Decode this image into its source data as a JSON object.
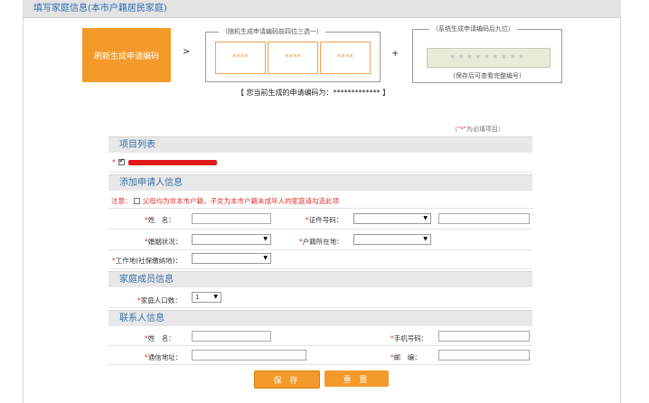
{
  "page": {
    "title": "填写家庭信息(本市户籍居民家庭)"
  },
  "code_gen": {
    "refresh_label": "刷新生成申请编码",
    "gt": ">",
    "plus": "+",
    "random_legend": "（随机生成申请编码前四位三选一）",
    "random_codes": [
      "****",
      "****",
      "****"
    ],
    "system_legend": "（系统生成申请编码后九位）",
    "system_code": "*********",
    "system_note": "(保存后可查看完整编号)",
    "current_code": "【 您当前生成的申请编码为：************* 】"
  },
  "required_note": {
    "prefix": "（",
    "mark": "\"*\"",
    "suffix": "为必填项目）"
  },
  "project_list": {
    "title": "项目列表",
    "item_star": "*"
  },
  "applicant": {
    "title": "添加申请人信息",
    "notice_prefix": "注意：",
    "notice_text": "父母均为非本市户籍，子女为本市户籍未成年人的家庭请勾选此项",
    "name_label": "姓　名：",
    "id_label": "证件号码：",
    "marital_label": "婚姻状况：",
    "hukou_label": "户籍所在地：",
    "work_label": "工作地(社保缴纳地)："
  },
  "family": {
    "title": "家庭成员信息",
    "count_label": "家庭人口数：",
    "count_value": "1"
  },
  "contact": {
    "title": "联系人信息",
    "name_label": "姓　名：",
    "phone_label": "手机号码：",
    "address_label": "通信地址：",
    "postcode_label": "邮　编："
  },
  "buttons": {
    "save": "保 存",
    "reset": "重 置"
  },
  "colors": {
    "accent": "#f39a2a",
    "section_title": "#3a6fa8",
    "required": "#e0322a"
  }
}
